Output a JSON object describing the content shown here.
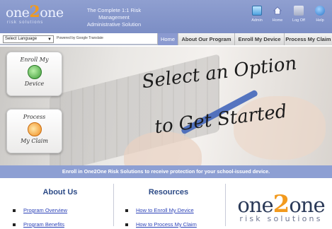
{
  "header": {
    "logo_word_pre": "one",
    "logo_word_two": "2",
    "logo_word_post": "one",
    "logo_sub": "risk solutions",
    "tagline_line1": "The Complete 1:1 Risk Management",
    "tagline_line2": "Administrative Solution",
    "icons": [
      {
        "label": "Admin",
        "icon": "admin-icon"
      },
      {
        "label": "Home",
        "icon": "home-icon"
      },
      {
        "label": "Log Off",
        "icon": "logoff-icon"
      },
      {
        "label": "Help",
        "icon": "help-icon"
      }
    ]
  },
  "navbar": {
    "language_select": "Select Language",
    "powered_by": "Powered by Google Translate",
    "tabs": [
      {
        "label": "Home",
        "active": true
      },
      {
        "label": "About Our Program",
        "active": false
      },
      {
        "label": "Enroll My Device",
        "active": false
      },
      {
        "label": "Process My Claim",
        "active": false
      }
    ]
  },
  "hero": {
    "line1": "Select an Option",
    "line2": "to Get Started",
    "cards": [
      {
        "line1": "Enroll My",
        "line2": "Device",
        "icon": "device-icon"
      },
      {
        "line1": "Process",
        "line2": "My Claim",
        "icon": "claim-icon"
      }
    ],
    "banner": "Enroll in One2One Risk Solutions to receive protection for your school-issued device."
  },
  "bottom": {
    "about": {
      "title": "About Us",
      "links": [
        "Program Overview",
        "Program Benefits"
      ]
    },
    "resources": {
      "title": "Resources",
      "links": [
        "How to Enroll My Device",
        "How to Process My Claim"
      ]
    },
    "logo_pre": "one",
    "logo_two": "2",
    "logo_post": "one",
    "logo_sub": "risk solutions"
  },
  "colors": {
    "header_blue": "#8b9ad0",
    "accent_orange": "#f29a1e",
    "title_navy": "#2c4a86",
    "link_blue": "#2d43b8"
  }
}
